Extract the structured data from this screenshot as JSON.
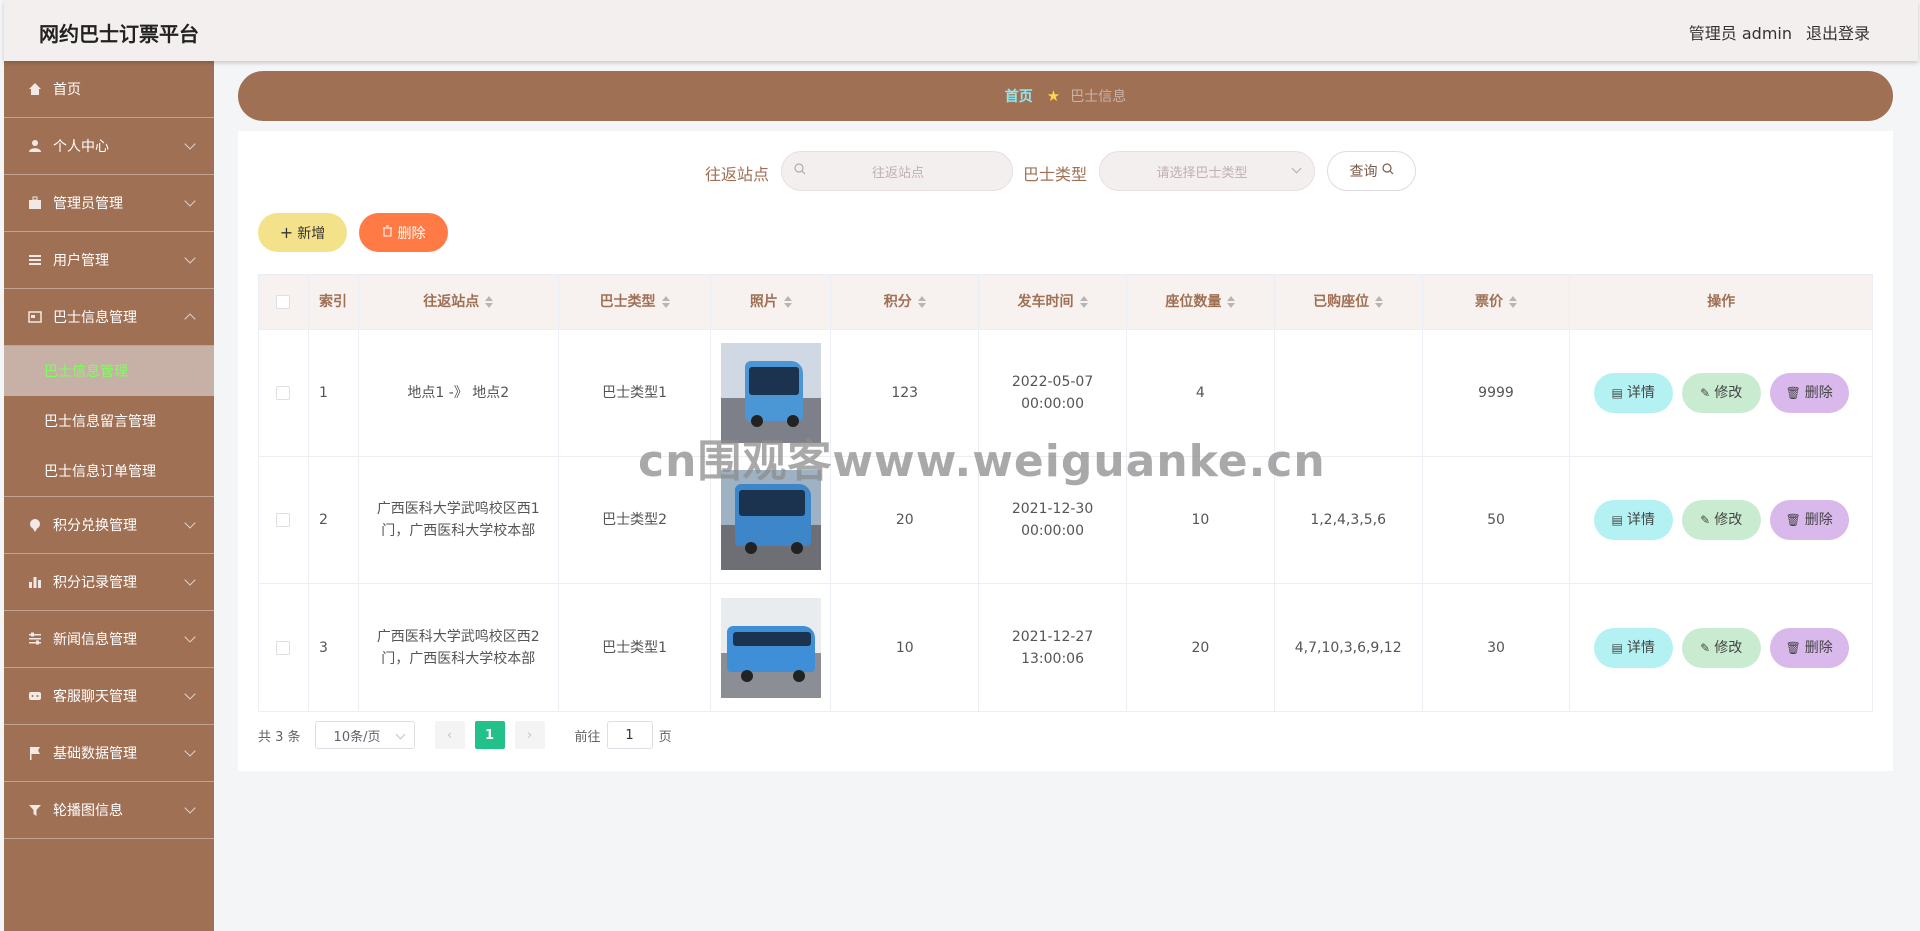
{
  "header": {
    "title": "网约巴士订票平台",
    "admin": "管理员 admin",
    "logout": "退出登录"
  },
  "sidebar": {
    "items": [
      {
        "label": "首页",
        "icon": "home-icon"
      },
      {
        "label": "个人中心",
        "icon": "user-icon"
      },
      {
        "label": "管理员管理",
        "icon": "briefcase-icon"
      },
      {
        "label": "用户管理",
        "icon": "list-icon"
      },
      {
        "label": "巴士信息管理",
        "icon": "card-icon"
      },
      {
        "label": "积分兑换管理",
        "icon": "pin-icon"
      },
      {
        "label": "积分记录管理",
        "icon": "bar-chart-icon"
      },
      {
        "label": "新闻信息管理",
        "icon": "sliders-icon"
      },
      {
        "label": "客服聊天管理",
        "icon": "chat-icon"
      },
      {
        "label": "基础数据管理",
        "icon": "flag-icon"
      },
      {
        "label": "轮播图信息",
        "icon": "funnel-icon"
      }
    ],
    "submenu": [
      "巴士信息管理",
      "巴士信息留言管理",
      "巴士信息订单管理"
    ]
  },
  "breadcrumb": {
    "home": "首页",
    "current": "巴士信息"
  },
  "search": {
    "station_label": "往返站点",
    "station_placeholder": "往返站点",
    "type_label": "巴士类型",
    "type_placeholder": "请选择巴士类型",
    "query": "查询"
  },
  "actions": {
    "add": "新增",
    "delete": "删除"
  },
  "table": {
    "headers": [
      "索引",
      "往返站点",
      "巴士类型",
      "照片",
      "积分",
      "发车时间",
      "座位数量",
      "已购座位",
      "票价",
      "操作"
    ],
    "rows": [
      {
        "index": "1",
        "station": "地点1 -》 地点2",
        "type": "巴士类型1",
        "points": "123",
        "time": "2022-05-07 00:00:00",
        "seats": "4",
        "booked": "",
        "price": "9999"
      },
      {
        "index": "2",
        "station": "广西医科大学武鸣校区西1门，广西医科大学校本部",
        "type": "巴士类型2",
        "points": "20",
        "time": "2021-12-30 00:00:00",
        "seats": "10",
        "booked": "1,2,4,3,5,6",
        "price": "50"
      },
      {
        "index": "3",
        "station": "广西医科大学武鸣校区西2门，广西医科大学校本部",
        "type": "巴士类型1",
        "points": "10",
        "time": "2021-12-27 13:00:06",
        "seats": "20",
        "booked": "4,7,10,3,6,9,12",
        "price": "30"
      }
    ],
    "row_actions": {
      "detail": "详情",
      "edit": "修改",
      "delete": "删除"
    }
  },
  "pager": {
    "total": "共 3 条",
    "size": "10条/页",
    "current": "1",
    "goto_prefix": "前往",
    "goto_value": "1",
    "goto_suffix": "页"
  },
  "watermark": "cn围观客www.weiguanke.cn",
  "colors": {
    "brand": "#a07055",
    "header_bg": "#f4efef",
    "active_sub": "#7dff5e",
    "page_active": "#22c18a"
  }
}
